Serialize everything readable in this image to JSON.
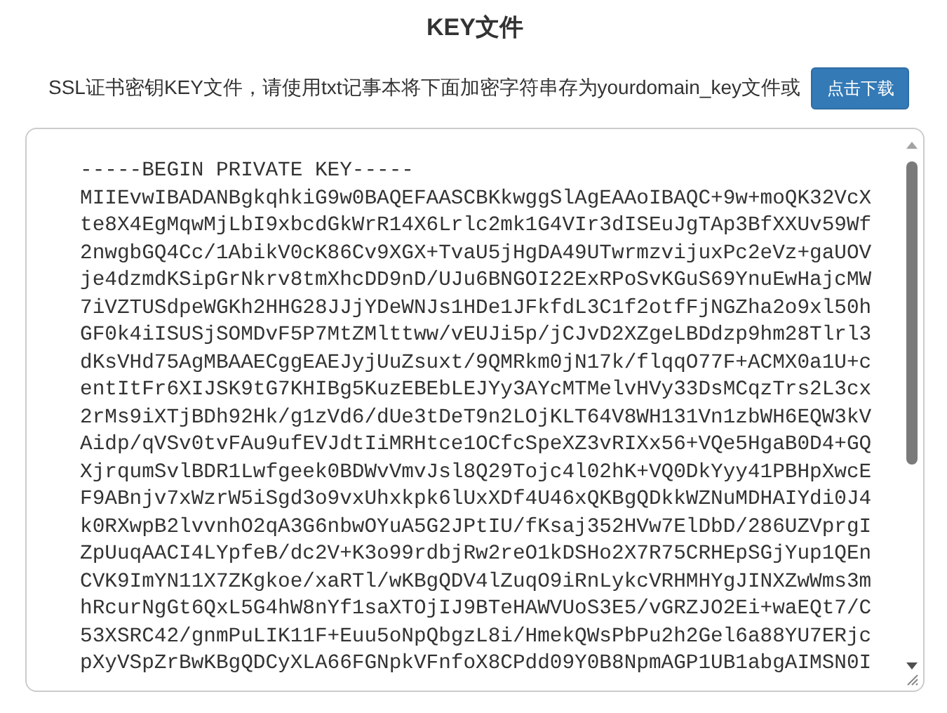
{
  "title": "KEY文件",
  "instruction": "SSL证书密钥KEY文件，请使用txt记事本将下面加密字符串存为yourdomain_key文件或",
  "download_button": "点击下载",
  "key_lines": [
    "-----BEGIN PRIVATE KEY-----",
    "MIIEvwIBADANBgkqhkiG9w0BAQEFAASCBKkwggSlAgEAAoIBAQC+9w+moQK32VcX",
    "te8X4EgMqwMjLbI9xbcdGkWrR14X6Lrlc2mk1G4VIr3dISEuJgTAp3BfXXUv59Wf",
    "2nwgbGQ4Cc/1AbikV0cK86Cv9XGX+TvaU5jHgDA49UTwrmzvijuxPc2eVz+gaUOV",
    "je4dzmdKSipGrNkrv8tmXhcDD9nD/UJu6BNGOI22ExRPoSvKGuS69YnuEwHajcMW",
    "7iVZTUSdpeWGKh2HHG28JJjYDeWNJs1HDe1JFkfdL3C1f2otfFjNGZha2o9xl50h",
    "GF0k4iISUSjSOMDvF5P7MtZMlttww/vEUJi5p/jCJvD2XZgeLBDdzp9hm28Tlrl3",
    "dKsVHd75AgMBAAECggEAEJyjUuZsuxt/9QMRkm0jN17k/flqqO77F+ACMX0a1U+c",
    "entItFr6XIJSK9tG7KHIBg5KuzEBEbLEJYy3AYcMTMelvHVy33DsMCqzTrs2L3cx",
    "2rMs9iXTjBDh92Hk/g1zVd6/dUe3tDeT9n2LOjKLT64V8WH131Vn1zbWH6EQW3kV",
    "Aidp/qVSv0tvFAu9ufEVJdtIiMRHtce1OCfcSpeXZ3vRIXx56+VQe5HgaB0D4+GQ",
    "XjrqumSvlBDR1Lwfgeek0BDWvVmvJsl8Q29Tojc4l02hK+VQ0DkYyy41PBHpXwcE",
    "F9ABnjv7xWzrW5iSgd3o9vxUhxkpk6lUxXDf4U46xQKBgQDkkWZNuMDHAIYdi0J4",
    "k0RXwpB2lvvnhO2qA3G6nbwOYuA5G2JPtIU/fKsaj352HVw7ElDbD/286UZVprgI",
    "ZpUuqAACI4LYpfeB/dc2V+K3o99rdbjRw2reO1kDSHo2X7R75CRHEpSGjYup1QEn",
    "CVK9ImYN11X7ZKgkoe/xaRTl/wKBgQDV4lZuqO9iRnLykcVRHMHYgJINXZwWms3m",
    "hRcurNgGt6QxL5G4hW8nYf1saXTOjIJ9BTeHAWVUoS3E5/vGRZJO2Ei+waEQt7/C",
    "53XSRC42/gnmPuLIK11F+Euu5oNpQbgzL8i/HmekQWsPbPu2h2Gel6a88YU7ERjc",
    "pXyVSpZrBwKBgQDCyXLA66FGNpkVFnfoX8CPdd09Y0B8NpmAGP1UB1abgAIMSN0I"
  ]
}
